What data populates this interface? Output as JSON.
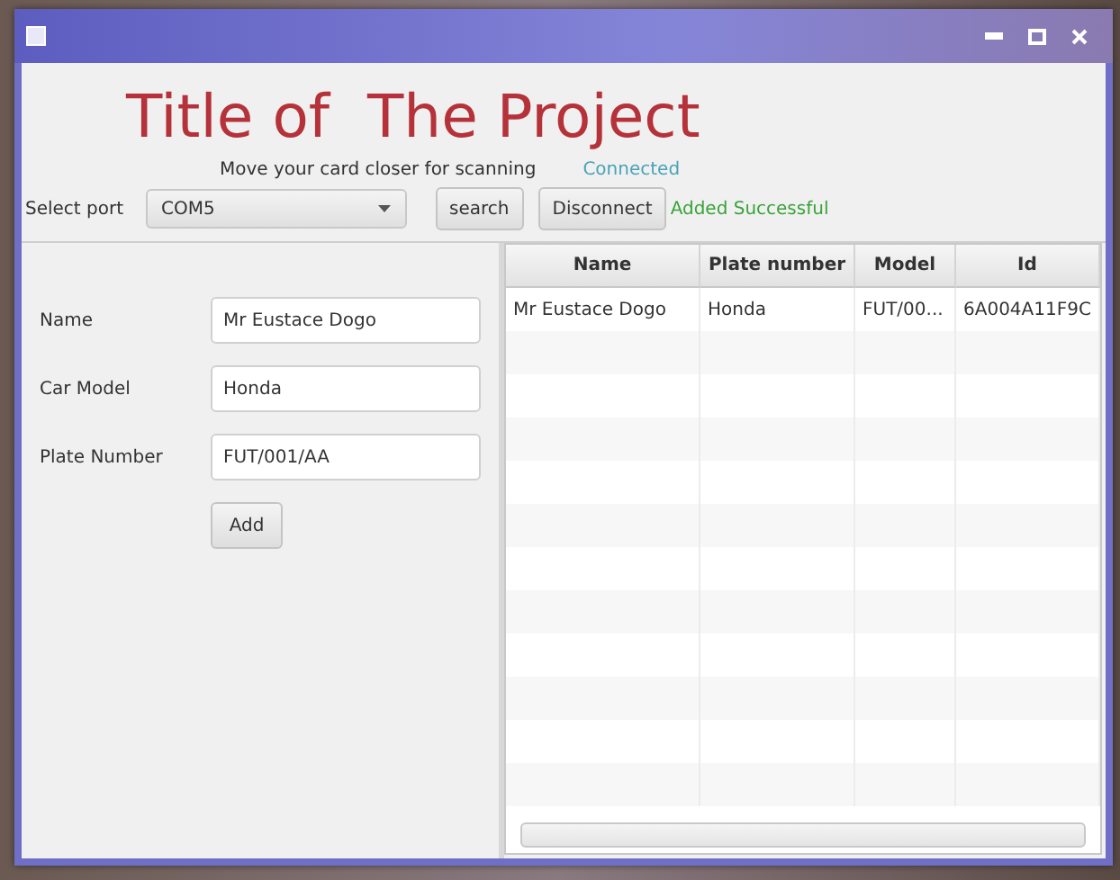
{
  "title": "Title of  The Project",
  "hint": "Move your card closer for scanning",
  "connection_status": "Connected",
  "port": {
    "label": "Select port",
    "value": "COM5"
  },
  "buttons": [
    "search",
    "Disconnect"
  ],
  "message": "Added Successful",
  "form": [
    {
      "label": "Name",
      "value": "Mr Eustace Dogo"
    },
    {
      "label": "Car Model",
      "value": "Honda"
    },
    {
      "label": "Plate Number",
      "value": "FUT/001/AA"
    }
  ],
  "add_button": "Add",
  "table": {
    "columns": [
      "Name",
      "Plate number",
      "Model",
      "Id"
    ],
    "rows": [
      [
        "Mr Eustace Dogo",
        "Honda",
        "FUT/00...",
        "6A004A11F9C"
      ]
    ]
  }
}
